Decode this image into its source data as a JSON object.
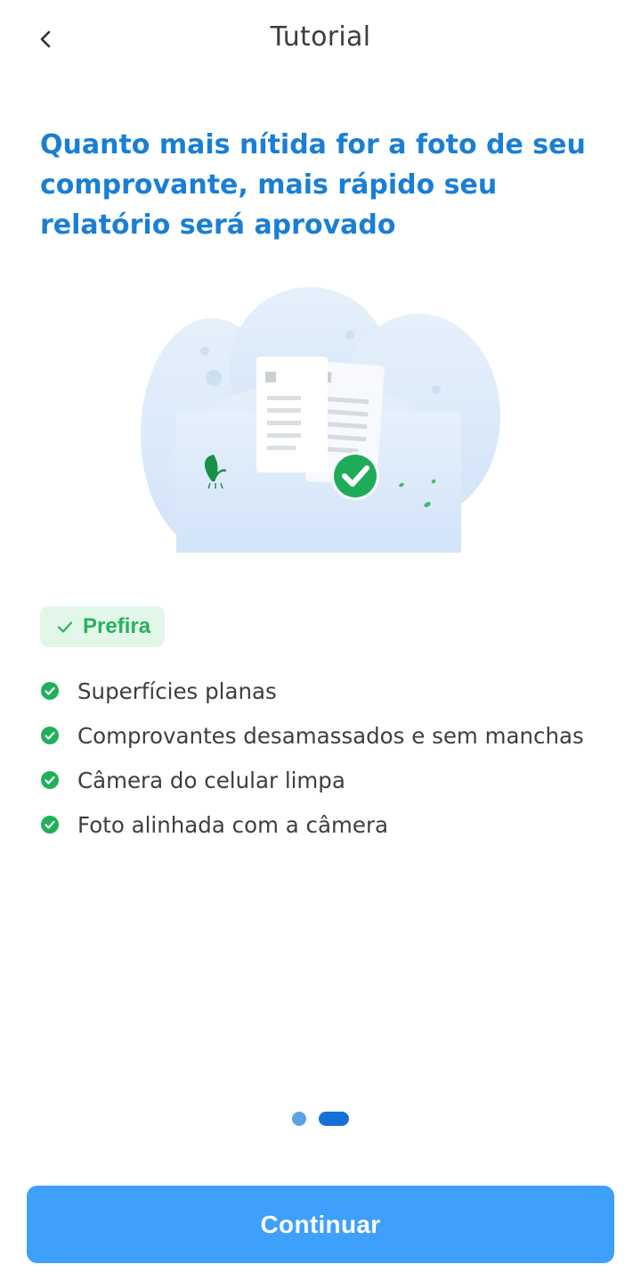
{
  "header": {
    "title": "Tutorial",
    "back_icon": "chevron-left-icon"
  },
  "headline": "Quanto mais nítida for a foto de seu comprovante, mais rápido seu relatório será aprovado",
  "illustration": {
    "icon": "approved-receipts-illustration",
    "badge_color": "#1fac59"
  },
  "prefer_badge": {
    "label": "Prefira",
    "icon": "check-icon"
  },
  "tips": [
    {
      "text": "Superfícies planas",
      "icon": "check-circle-icon"
    },
    {
      "text": "Comprovantes desamassados e sem manchas",
      "icon": "check-circle-icon"
    },
    {
      "text": "Câmera do celular limpa",
      "icon": "check-circle-icon"
    },
    {
      "text": "Foto alinhada com a câmera",
      "icon": "check-circle-icon"
    }
  ],
  "pager": {
    "total": 2,
    "current": 2
  },
  "cta": {
    "label": "Continuar"
  },
  "colors": {
    "accent": "#1a7fd4",
    "button": "#3fa0fb",
    "success": "#2ab25d"
  }
}
